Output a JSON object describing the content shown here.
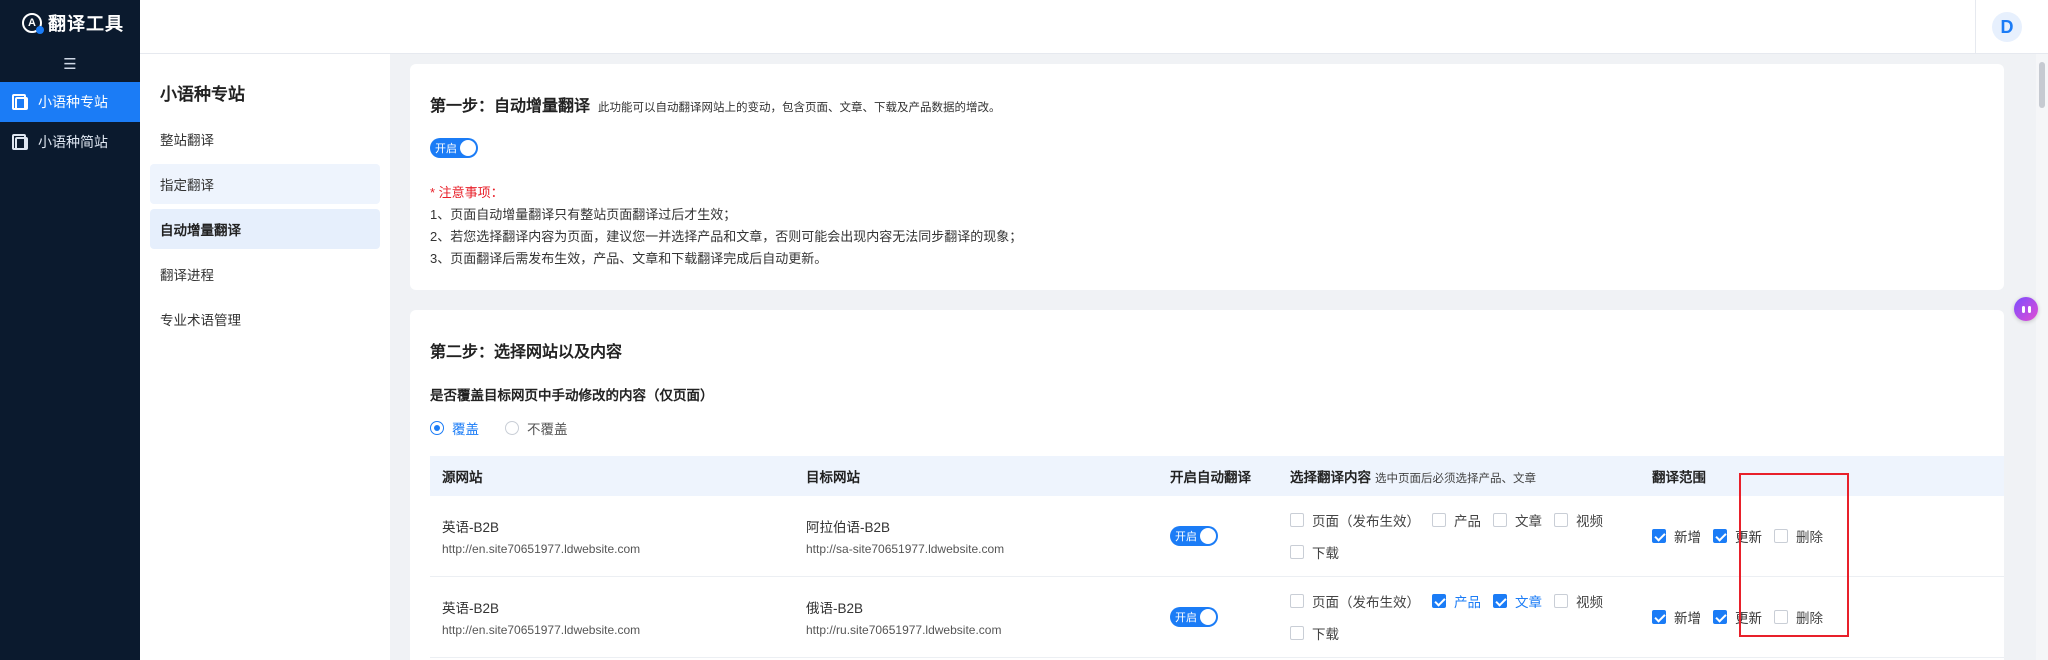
{
  "app": {
    "title": "翻译工具",
    "logo_letter": "A",
    "avatar": "D",
    "collapse_glyph": "☰"
  },
  "sidebar": {
    "items": [
      {
        "label": "小语种专站",
        "active": true
      },
      {
        "label": "小语种简站",
        "active": false
      }
    ]
  },
  "submenu": {
    "title": "小语种专站",
    "items": [
      {
        "label": "整站翻译"
      },
      {
        "label": "指定翻译"
      },
      {
        "label": "自动增量翻译"
      },
      {
        "label": "翻译进程"
      },
      {
        "label": "专业术语管理"
      }
    ]
  },
  "step1": {
    "title": "第一步：自动增量翻译",
    "desc": "此功能可以自动翻译网站上的变动，包含页面、文章、下载及产品数据的增改。",
    "switch_label": "开启",
    "notes_head": "* 注意事项：",
    "notes": [
      "1、页面自动增量翻译只有整站页面翻译过后才生效；",
      "2、若您选择翻译内容为页面，建议您一并选择产品和文章，否则可能会出现内容无法同步翻译的现象；",
      "3、页面翻译后需发布生效，产品、文章和下载翻译完成后自动更新。"
    ]
  },
  "step2": {
    "title": "第二步：选择网站以及内容",
    "question": "是否覆盖目标网页中手动修改的内容（仅页面）",
    "radio_cover": "覆盖",
    "radio_no_cover": "不覆盖",
    "table": {
      "headers": {
        "source": "源网站",
        "target": "目标网站",
        "auto": "开启自动翻译",
        "content": "选择翻译内容",
        "content_note": "选中页面后必须选择产品、文章",
        "scope": "翻译范围"
      },
      "rows": [
        {
          "source_name": "英语-B2B",
          "source_url": "http://en.site70651977.ldwebsite.com",
          "target_name": "阿拉伯语-B2B",
          "target_url": "http://sa-site70651977.ldwebsite.com",
          "switch": "开启",
          "opt_page": "页面（发布生效）",
          "opt_product": "产品",
          "opt_article": "文章",
          "opt_video": "视频",
          "opt_download": "下载",
          "scope_add": "新增",
          "scope_update": "更新",
          "scope_delete": "删除"
        },
        {
          "source_name": "英语-B2B",
          "source_url": "http://en.site70651977.ldwebsite.com",
          "target_name": "俄语-B2B",
          "target_url": "http://ru.site70651977.ldwebsite.com",
          "switch": "开启",
          "opt_page": "页面（发布生效）",
          "opt_product": "产品",
          "opt_article": "文章",
          "opt_video": "视频",
          "opt_download": "下载",
          "scope_add": "新增",
          "scope_update": "更新",
          "scope_delete": "删除"
        }
      ]
    }
  },
  "colors": {
    "primary": "#1b7cf6",
    "sidebar_bg": "#0b1a2e",
    "warning": "#e8202a"
  }
}
